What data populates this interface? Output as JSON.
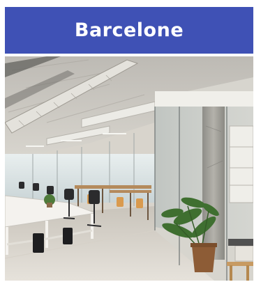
{
  "card": {
    "title": "Barcelone"
  },
  "colors": {
    "title_bar_bg": "#3f51b5",
    "title_text": "#ffffff"
  },
  "photo": {
    "subject": "office-interior-photo"
  }
}
